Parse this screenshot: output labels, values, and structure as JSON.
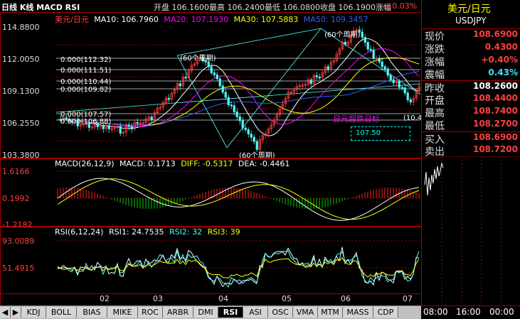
{
  "header": {
    "title": "日线 K线 MACD RSI",
    "quote_line": "开盘 106.1600最高 106.2400最低 106.0800收盘 106.1900涨幅",
    "change_pct": "+0.03%"
  },
  "main_chart": {
    "legend": {
      "symbol": "美元/日元",
      "ma10": "MA10: 106.7960",
      "ma20": "MA20: 107.1930",
      "ma30": "MA30: 107.5883",
      "ma50": "MA50: 109.3457"
    },
    "y_ticks": [
      "114.8800",
      "112.0050",
      "109.1300",
      "106.2550",
      "103.3800"
    ],
    "annotations": {
      "levels": [
        "0.000(112.32)",
        "0.000(111.51)",
        "0.000(110.44)",
        "0.000(109.82)",
        "0.000(107.57)",
        "0.000(106.88)"
      ],
      "cycle_labels": [
        "(60个周期)",
        "(60个周期)",
        "(60个周期)",
        "(60个周期)"
      ],
      "event_text": "日元超跌日标",
      "price_box": "107.50",
      "right_value": "(10.4"
    }
  },
  "macd_chart": {
    "legend": {
      "name": "MACD(26,12,9)",
      "macd": "MACD: 0.1713",
      "diff": "DIFF: -0.5317",
      "dea": "DEA: -0.4461"
    },
    "y_ticks": [
      "1.6166",
      "0.1992",
      "-1.2182"
    ]
  },
  "rsi_chart": {
    "legend": {
      "name": "RSI(6,12,24)",
      "rsi1": "RSI1: 24.7535",
      "rsi2": "RSI2: 32",
      "rsi3": "RSI3: 39"
    },
    "y_ticks": [
      "93.0089",
      "51.4915"
    ]
  },
  "x_axis": [
    "02",
    "03",
    "04",
    "05",
    "06",
    "07"
  ],
  "quote_panel": {
    "title": "美元/日元",
    "code": "USDJPY",
    "rows": [
      {
        "label": "现价",
        "value": "108.6900",
        "color": "#ff4040"
      },
      {
        "label": "涨跌",
        "value": "0.4300",
        "color": "#ff4040"
      },
      {
        "label": "涨幅",
        "value": "+0.40%",
        "color": "#ff4040"
      },
      {
        "label": "震幅",
        "value": "0.43%",
        "color": "#40e0ff"
      },
      {
        "label": "昨收",
        "value": "108.2600",
        "color": "#ffffff"
      },
      {
        "label": "开盘",
        "value": "108.4400",
        "color": "#ff4040"
      },
      {
        "label": "最高",
        "value": "108.7400",
        "color": "#ff4040"
      },
      {
        "label": "最低",
        "value": "108.2700",
        "color": "#ff4040"
      },
      {
        "label": "买入",
        "value": "108.6900",
        "color": "#ff4040"
      },
      {
        "label": "卖出",
        "value": "108.7200",
        "color": "#ff4040"
      }
    ],
    "time_labels": [
      "08:00",
      "16:00",
      "00:00"
    ]
  },
  "tabs": [
    "KDJ",
    "BOLL",
    "BIAS",
    "MIKE",
    "ROC",
    "ARBR",
    "DMI",
    "RSI",
    "ASI",
    "OSC",
    "VMA",
    "MTM",
    "MASS",
    "CDP"
  ],
  "active_tab": "RSI",
  "colors": {
    "up": "#ff4040",
    "down": "#54fcfc",
    "ma10": "#ffffff",
    "ma20": "#ff00ff",
    "ma30": "#ffff00",
    "ma50": "#3060ff",
    "macd_pos": "#ff2020",
    "macd_neg": "#00d000"
  }
}
